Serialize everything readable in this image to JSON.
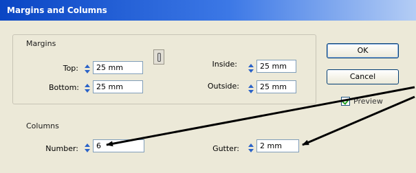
{
  "window": {
    "title": "Margins and Columns"
  },
  "margins": {
    "group_label": "Margins",
    "top_label": "Top:",
    "top_value": "25 mm",
    "bottom_label": "Bottom:",
    "bottom_value": "25 mm",
    "inside_label": "Inside:",
    "inside_value": "25 mm",
    "outside_label": "Outside:",
    "outside_value": "25 mm"
  },
  "columns": {
    "group_label": "Columns",
    "number_label": "Number:",
    "number_value": "6",
    "gutter_label": "Gutter:",
    "gutter_value": "2 mm"
  },
  "buttons": {
    "ok": "OK",
    "cancel": "Cancel"
  },
  "preview": {
    "label": "Preview",
    "checked": true
  },
  "colors": {
    "title_bar": "#0a46c4",
    "dialog_bg": "#ece9d8",
    "spinner_arrow": "#2a62c8",
    "annotation_arrow": "#000000"
  }
}
